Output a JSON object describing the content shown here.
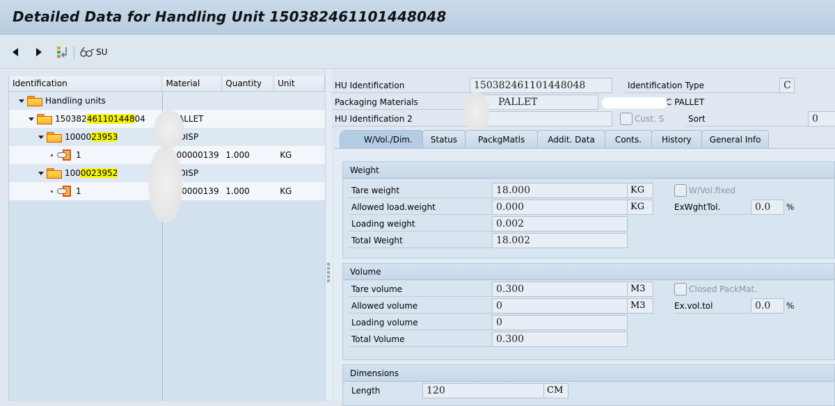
{
  "window": {
    "title": "Detailed Data for Handling Unit 150382461101448048"
  },
  "toolbar": {
    "back_icon": "triangle-left",
    "forward_icon": "triangle-right",
    "hierarchy_icon": "traffic-light-return",
    "su_label": "SU",
    "su_icon": "glasses"
  },
  "tree": {
    "columns": [
      "Identification",
      "Material",
      "Quantity",
      "Unit"
    ],
    "rows": [
      {
        "level": 0,
        "type": "folder",
        "id": "Handling units",
        "material": "",
        "quantity": "",
        "unit": ""
      },
      {
        "level": 1,
        "type": "folder",
        "id_plain": "150382",
        "id_hl": "461101448",
        "id_rest": "04",
        "material": "PALLET",
        "quantity": "",
        "unit": ""
      },
      {
        "level": 2,
        "type": "folder",
        "id_plain": "10000",
        "id_hl": "23953",
        "id_rest": "",
        "material": "DISP",
        "quantity": "",
        "unit": ""
      },
      {
        "level": 3,
        "type": "item",
        "id": "1",
        "material": "00000139",
        "quantity": "1.000",
        "unit": "KG"
      },
      {
        "level": 2,
        "type": "folder",
        "id_plain": "100",
        "id_hl": "0023952",
        "id_rest": "",
        "material": "DISP",
        "quantity": "",
        "unit": ""
      },
      {
        "level": 3,
        "type": "item",
        "id": "1",
        "material": "00000139",
        "quantity": "1.000",
        "unit": "KG"
      }
    ]
  },
  "header": {
    "hu_identification_label": "HU Identification",
    "hu_identification_value": "150382461101448048",
    "identification_type_label": "Identification Type",
    "identification_type_value": "C",
    "packaging_materials_label": "Packaging Materials",
    "packaging_materials_value": "PALLET",
    "packaging_materials_desc": "C PALLET",
    "hu_identification2_label": "HU Identification 2",
    "hu_identification2_value": "",
    "cust_s_label": "Cust. S",
    "sort_label": "Sort",
    "sort_value": "0"
  },
  "tabs": [
    {
      "label": "W/Vol./Dim.",
      "active": true
    },
    {
      "label": "Status"
    },
    {
      "label": "PackgMatls"
    },
    {
      "label": "Addit. Data"
    },
    {
      "label": "Conts."
    },
    {
      "label": "History"
    },
    {
      "label": "General Info"
    }
  ],
  "weight": {
    "title": "Weight",
    "tare_label": "Tare weight",
    "tare_value": "18.000",
    "tare_unit": "KG",
    "allowed_label": "Allowed load.weight",
    "allowed_value": "0.000",
    "allowed_unit": "KG",
    "loading_label": "Loading weight",
    "loading_value": "0.002",
    "total_label": "Total Weight",
    "total_value": "18.002",
    "fixed_label": "W/Vol.fixed",
    "tol_label": "ExWghtTol.",
    "tol_value": "0.0",
    "tol_unit": "%"
  },
  "volume": {
    "title": "Volume",
    "tare_label": "Tare volume",
    "tare_value": "0.300",
    "tare_unit": "M3",
    "allowed_label": "Allowed volume",
    "allowed_value": "0",
    "allowed_unit": "M3",
    "loading_label": "Loading volume",
    "loading_value": "0",
    "total_label": "Total Volume",
    "total_value": "0.300",
    "closed_label": "Closed PackMat.",
    "tol_label": "Ex.vol.tol",
    "tol_value": "0.0",
    "tol_unit": "%"
  },
  "dimensions": {
    "title": "Dimensions",
    "length_label": "Length",
    "length_value": "120",
    "length_unit": "CM"
  }
}
